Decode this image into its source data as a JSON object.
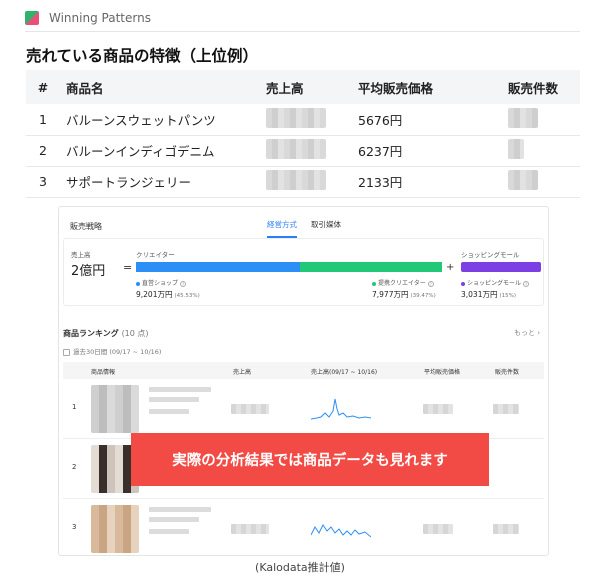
{
  "header": {
    "title": "Winning Patterns"
  },
  "section": {
    "title": "売れている商品の特徴（上位例）"
  },
  "top_table": {
    "columns": [
      "#",
      "商品名",
      "売上高",
      "平均販売価格",
      "販売件数"
    ],
    "rows": [
      {
        "no": "1",
        "name": "バルーンスウェットパンツ",
        "price": "5676円"
      },
      {
        "no": "2",
        "name": "バルーンインディゴデニム",
        "price": "6237円"
      },
      {
        "no": "3",
        "name": "サポートランジェリー",
        "price": "2133円"
      }
    ]
  },
  "panel": {
    "strategy_label": "販売戦略",
    "tabs": [
      "経営方式",
      "取引媒体"
    ],
    "sales_label": "売上高",
    "sales_value": "2億円",
    "equals": "=",
    "plus": "+",
    "creator_label": "クリエイター",
    "mall_label": "ショッピングモール",
    "seg_own_label": "直営ショップ",
    "seg_own_value": "9,201万円",
    "seg_own_pct": "(45.53%)",
    "seg_creator_label": "提携クリエイター",
    "seg_creator_value": "7,977万円",
    "seg_creator_pct": "(39.47%)",
    "seg_mall_label": "ショッピングモール",
    "seg_mall_value": "3,031万円",
    "seg_mall_pct": "(15%)",
    "colors": {
      "own": "#2b8ff5",
      "creator": "#20c878",
      "mall": "#7b3fe4"
    },
    "segment_shares": {
      "own": 45.53,
      "creator": 39.47,
      "mall": 15
    }
  },
  "ranking": {
    "title": "商品ランキング",
    "count": "(10 点)",
    "more": "もっと ›",
    "period": "過去30日間 (09/17 ~ 10/16)",
    "columns": [
      "商品情報",
      "売上高",
      "売上高(09/17 ~ 10/16)",
      "平均販売価格",
      "販売件数"
    ],
    "rows": [
      {
        "rank": "1"
      },
      {
        "rank": "2"
      },
      {
        "rank": "3"
      }
    ]
  },
  "overlay": {
    "text": "実際の分析結果では商品データも見れます"
  },
  "caption": {
    "text": "(Kalodata推計値)"
  }
}
